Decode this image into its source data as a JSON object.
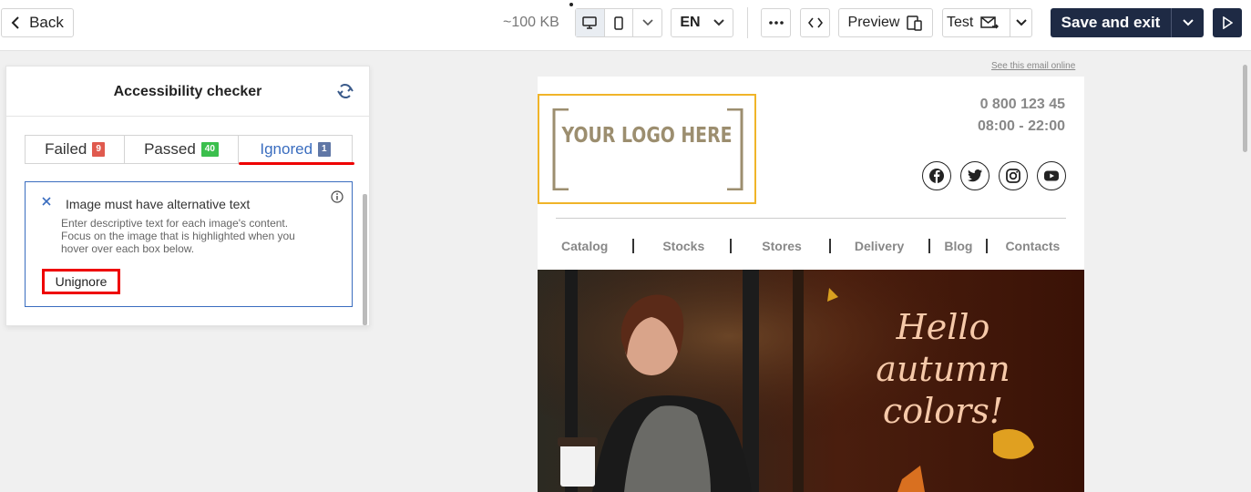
{
  "toolbar": {
    "back_label": "Back",
    "size_label": "~100 KB",
    "language": "EN",
    "preview_label": "Preview",
    "test_label": "Test",
    "save_label": "Save and exit"
  },
  "panel": {
    "title": "Accessibility checker",
    "tabs": [
      {
        "label": "Failed",
        "count": "9",
        "color": "#e05a4e"
      },
      {
        "label": "Passed",
        "count": "40",
        "color": "#3bbf4d"
      },
      {
        "label": "Ignored",
        "count": "1",
        "color": "#6077a6",
        "active": true
      }
    ],
    "issue": {
      "title": "Image must have alternative text",
      "description": "Enter descriptive text for each image's content. Focus on the image that is highlighted when you hover over each box below.",
      "action": "Unignore"
    }
  },
  "email": {
    "see_online": "See this email online",
    "logo_text": "YOUR LOGO HERE",
    "phone": "0 800 123 45",
    "hours": "08:00 - 22:00",
    "social": [
      "facebook-icon",
      "twitter-icon",
      "instagram-icon",
      "youtube-icon"
    ],
    "nav": [
      "Catalog",
      "Stocks",
      "Stores",
      "Delivery",
      "Blog",
      "Contacts"
    ],
    "hero_text": "Hello autumn colors!"
  },
  "colors": {
    "accent": "#1e2a44",
    "highlight": "#ee0000",
    "link": "#3a6dbf",
    "logo_border": "#f0b429"
  }
}
